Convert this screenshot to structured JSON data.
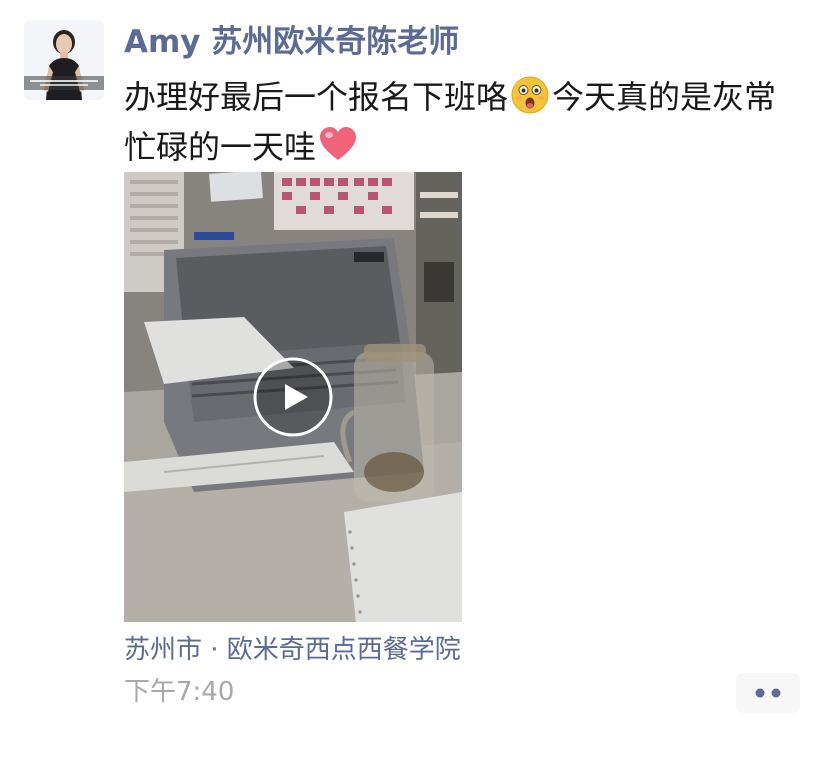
{
  "post": {
    "author": "Amy 苏州欧米奇陈老师",
    "text_part1": "办理好最后一个报名下班咯",
    "emoji1": "astonished-face-emoji",
    "text_part2": "今天真的是灰常忙碌的一天哇",
    "emoji2": "heart-emoji",
    "location": "苏州市 · 欧米奇西点西餐学院",
    "timestamp": "下午7:40"
  },
  "video": {
    "thumbnail": "video-thumbnail-printer-on-desk",
    "play_icon": "play-icon"
  },
  "actions": {
    "more_icon": "more-dots-icon"
  },
  "colors": {
    "author_name": "#5b6b93",
    "location": "#5b6b93",
    "timestamp": "#a8a8a8",
    "text": "#191919",
    "more_button_bg": "#f7f7f7"
  }
}
